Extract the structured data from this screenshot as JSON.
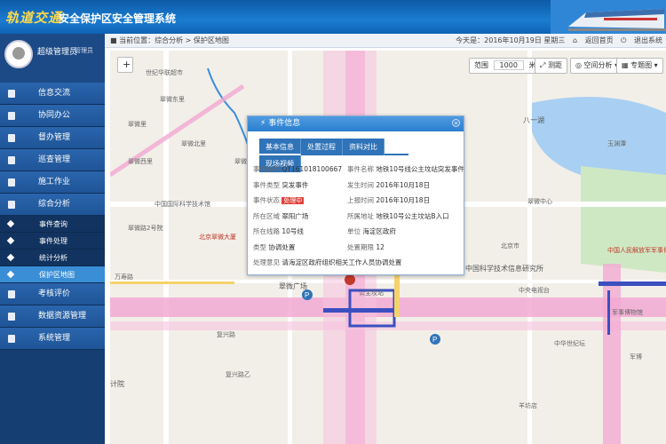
{
  "header": {
    "logo": "轨道交通",
    "system_title": "安全保护区安全管理系统"
  },
  "user": {
    "name": "超级管理员",
    "role": "管理员"
  },
  "menu": [
    {
      "label": "信息交流",
      "type": "main"
    },
    {
      "label": "协同办公",
      "type": "main"
    },
    {
      "label": "督办管理",
      "type": "main"
    },
    {
      "label": "巡查管理",
      "type": "main"
    },
    {
      "label": "施工作业",
      "type": "main"
    },
    {
      "label": "综合分析",
      "type": "main"
    },
    {
      "label": "事件查询",
      "type": "sub"
    },
    {
      "label": "事件处理",
      "type": "sub"
    },
    {
      "label": "统计分析",
      "type": "sub"
    },
    {
      "label": "保护区地图",
      "type": "sub",
      "active": true
    },
    {
      "label": "考核评价",
      "type": "main"
    },
    {
      "label": "数据资源管理",
      "type": "main"
    },
    {
      "label": "系统管理",
      "type": "main"
    }
  ],
  "breadcrumb": {
    "prefix": "当前位置：",
    "path": "综合分析 > 保护区地图",
    "date": "今天是：2016年10月19日 星期三",
    "home": "返回首页",
    "logout": "退出系统"
  },
  "toolbar": {
    "add": "+",
    "range_label": "范围",
    "range_value": "1000",
    "range_unit": "米",
    "measure": "测距",
    "spatial": "空间分析",
    "thematic": "专题图"
  },
  "popup": {
    "title": "事件信息",
    "close": "×",
    "tabs": [
      "基本信息",
      "处置过程",
      "资料对比",
      "现场视频"
    ],
    "rows": [
      {
        "k": "事件编号",
        "v": "QT161018100667",
        "k2": "事件名称",
        "v2": "地铁10号线公主坟站突发事件"
      },
      {
        "k": "事件类型",
        "v": "突发事件",
        "k2": "发生时间",
        "v2": "2016年10月18日"
      },
      {
        "k": "事件状态",
        "v": "处理中",
        "k2": "上报时间",
        "v2": "2016年10月18日"
      },
      {
        "k": "所在区域",
        "v": "翠阳广场",
        "k2": "所属地址",
        "v2": "地铁10号公主坟站B入口"
      },
      {
        "k": "所在线路",
        "v": "10号线",
        "k2": "单位",
        "v2": "海淀区政府"
      },
      {
        "k": "类型",
        "v": "协调处置",
        "k2": "处置期限",
        "v2": "12"
      },
      {
        "k": "处理意见",
        "v": "请海淀区政府组织相关工作人员协调处置"
      }
    ]
  },
  "map_labels": [
    {
      "t": "世纪华联超市"
    },
    {
      "t": "翠微东里"
    },
    {
      "t": "翠微里"
    },
    {
      "t": "翠微北里"
    },
    {
      "t": "翠微西里"
    },
    {
      "t": "中国国际科学技术馆"
    },
    {
      "t": "翠微路2号院"
    },
    {
      "t": "北京翠微大厦"
    },
    {
      "t": "翠微路"
    },
    {
      "t": "翠微广场"
    },
    {
      "t": "公主坟站"
    },
    {
      "t": "复兴路"
    },
    {
      "t": "中国科学技术信息研究所"
    },
    {
      "t": "中央电视台"
    },
    {
      "t": "军事博物馆"
    },
    {
      "t": "八一湖"
    },
    {
      "t": "玉渊潭"
    },
    {
      "t": "羊坊店"
    },
    {
      "t": "中国人民解放军军事博物馆"
    },
    {
      "t": "北京市"
    },
    {
      "t": "中华世纪坛"
    },
    {
      "t": "复兴路乙"
    },
    {
      "t": "万寿路"
    },
    {
      "t": "翠微中心"
    },
    {
      "t": "军博"
    },
    {
      "t": "计院"
    }
  ]
}
